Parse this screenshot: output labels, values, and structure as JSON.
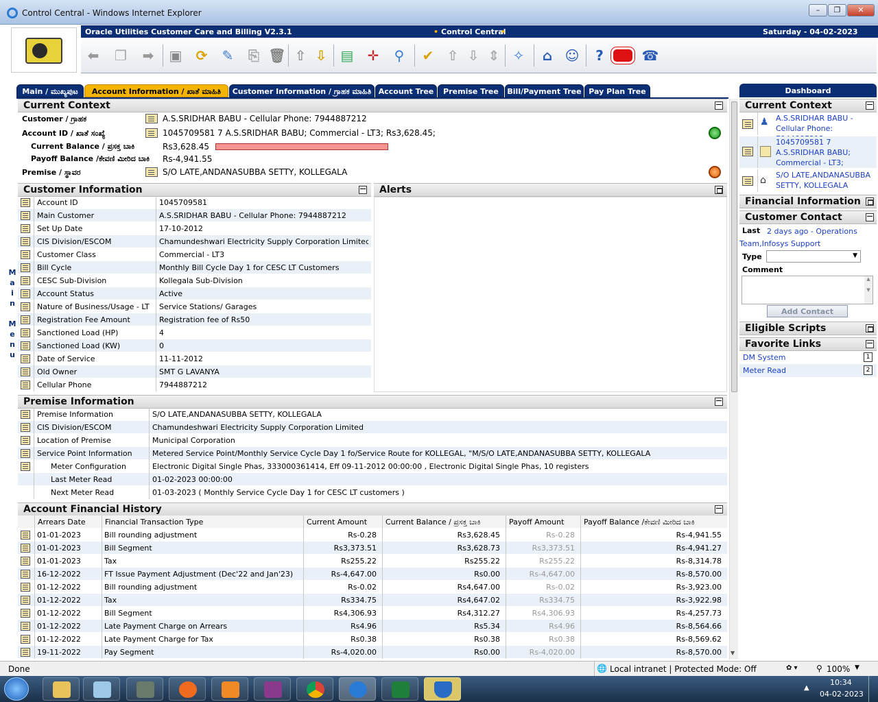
{
  "window": {
    "title": "Control Central - Windows Internet Explorer"
  },
  "app": {
    "product": "Oracle Utilities Customer Care and Billing V2.3.1",
    "portal": "Control Central",
    "date": "Saturday - 04-02-2023"
  },
  "tabs": [
    "Main / ಮುಖ್ಯಪುಟ",
    "Account Information / ಖಾತೆ ಮಾಹಿತಿ",
    "Customer Information / ಗ್ರಾಹಕ ಮಾಹಿತಿ",
    "Account Tree",
    "Premise Tree",
    "Bill/Payment Tree",
    "Pay Plan Tree"
  ],
  "main_menu": [
    "M",
    "a",
    "i",
    "n",
    "",
    "M",
    "e",
    "n",
    "u"
  ],
  "context": {
    "title": "Current Context",
    "customer_label": "Customer / ಗ್ರಾಹಕ",
    "customer_value": "A.S.SRIDHAR BABU - Cellular Phone: 7944887212",
    "account_label": "Account ID / ಖಾತೆ ಸಂಖ್ಯೆ",
    "account_value": "1045709581 7 A.S.SRIDHAR BABU; Commercial - LT3; Rs3,628.45;",
    "cur_bal_label": "Current Balance / ಪ್ರಸಕ್ತ ಬಾಕಿ",
    "cur_bal_value": "Rs3,628.45",
    "payoff_label": "Payoff Balance /ಕೇವಣಿ ಮೀರಿದ ಬಾಕಿ",
    "payoff_value": "Rs-4,941.55",
    "premise_label": "Premise / ಸ್ಥಾವರ",
    "premise_value": "S/O LATE,ANDANASUBBA SETTY, KOLLEGALA"
  },
  "customer_info": {
    "title": "Customer Information",
    "rows": [
      [
        "Account ID",
        "1045709581"
      ],
      [
        "Main Customer",
        "A.S.SRIDHAR BABU - Cellular Phone: 7944887212"
      ],
      [
        "Set Up Date",
        "17-10-2012"
      ],
      [
        "CIS Division/ESCOM",
        "Chamundeshwari Electricity Supply Corporation Limited"
      ],
      [
        "Customer Class",
        "Commercial - LT3"
      ],
      [
        "Bill Cycle",
        "Monthly Bill Cycle Day 1 for CESC LT Customers"
      ],
      [
        "CESC Sub-Division",
        "Kollegala Sub-Division"
      ],
      [
        "Account Status",
        "Active"
      ],
      [
        "Nature of Business/Usage - LT",
        "Service Stations/ Garages"
      ],
      [
        "Registration Fee Amount",
        "Registration fee of Rs50"
      ],
      [
        "Sanctioned Load (HP)",
        "4"
      ],
      [
        "Sanctioned Load (KW)",
        "0"
      ],
      [
        "Date of Service",
        "11-11-2012"
      ],
      [
        "Old Owner",
        "SMT G LAVANYA"
      ],
      [
        "Cellular Phone",
        "7944887212"
      ]
    ]
  },
  "alerts": {
    "title": "Alerts"
  },
  "premise_info": {
    "title": "Premise Information",
    "rows": [
      [
        "Premise Information",
        "S/O LATE,ANDANASUBBA SETTY, KOLLEGALA"
      ],
      [
        "CIS Division/ESCOM",
        "Chamundeshwari Electricity Supply Corporation Limited"
      ],
      [
        "Location of Premise",
        "Municipal Corporation"
      ],
      [
        "Service Point Information",
        "Metered Service Point/Monthly Service Cycle Day 1 fo/Service Route for KOLLEGAL, \"M/S/O LATE,ANDANASUBBA SETTY, KOLLEGALA"
      ],
      [
        "Meter Configuration",
        "Electronic Digital Single Phas, 333000361414, Eff 09-11-2012 00:00:00 , Electronic Digital Single Phas, 10 registers"
      ],
      [
        "Last Meter Read",
        "01-02-2023 00:00:00"
      ],
      [
        "Next Meter Read",
        "01-03-2023 ( Monthly Service Cycle Day 1 for CESC LT customers )"
      ]
    ]
  },
  "fin_history": {
    "title": "Account Financial History",
    "headers": [
      "Arrears Date",
      "Financial Transaction Type",
      "Current Amount",
      "Current Balance / ಪ್ರಸಕ್ತ ಬಾಕಿ",
      "Payoff Amount",
      "Payoff Balance /ಕೇವಣಿ ಮೀರಿದ ಬಾಕಿ"
    ],
    "rows": [
      [
        "01-01-2023",
        "Bill rounding adjustment",
        "Rs-0.28",
        "Rs3,628.45",
        "Rs-0.28",
        "Rs-4,941.55"
      ],
      [
        "01-01-2023",
        "Bill Segment",
        "Rs3,373.51",
        "Rs3,628.73",
        "Rs3,373.51",
        "Rs-4,941.27"
      ],
      [
        "01-01-2023",
        "Tax",
        "Rs255.22",
        "Rs255.22",
        "Rs255.22",
        "Rs-8,314.78"
      ],
      [
        "16-12-2022",
        "FT Issue Payment Adjustment (Dec'22 and Jan'23)",
        "Rs-4,647.00",
        "Rs0.00",
        "Rs-4,647.00",
        "Rs-8,570.00"
      ],
      [
        "01-12-2022",
        "Bill rounding adjustment",
        "Rs-0.02",
        "Rs4,647.00",
        "Rs-0.02",
        "Rs-3,923.00"
      ],
      [
        "01-12-2022",
        "Tax",
        "Rs334.75",
        "Rs4,647.02",
        "Rs334.75",
        "Rs-3,922.98"
      ],
      [
        "01-12-2022",
        "Bill Segment",
        "Rs4,306.93",
        "Rs4,312.27",
        "Rs4,306.93",
        "Rs-4,257.73"
      ],
      [
        "01-12-2022",
        "Late Payment Charge on Arrears",
        "Rs4.96",
        "Rs5.34",
        "Rs4.96",
        "Rs-8,564.66"
      ],
      [
        "01-12-2022",
        "Late Payment Charge for Tax",
        "Rs0.38",
        "Rs0.38",
        "Rs0.38",
        "Rs-8,569.62"
      ],
      [
        "19-11-2022",
        "Pay Segment",
        "Rs-4,020.00",
        "Rs0.00",
        "Rs-4,020.00",
        "Rs-8,570.00"
      ]
    ]
  },
  "dashboard": {
    "title": "Dashboard",
    "current_context": "Current Context",
    "ctx_customer": "A.S.SRIDHAR BABU - Cellular Phone: 7944887212",
    "ctx_account": "1045709581 7 A.S.SRIDHAR BABU; Commercial - LT3; Rs3,628.45;",
    "ctx_premise": "S/O LATE,ANDANASUBBA SETTY, KOLLEGALA",
    "financial_info": "Financial Information",
    "customer_contact": "Customer Contact",
    "last_label": "Last",
    "last_value": "2 days ago - Operations Team,Infosys Support",
    "type_label": "Type",
    "comment_label": "Comment",
    "add_contact": "Add Contact",
    "eligible_scripts": "Eligible Scripts",
    "favorite_links": "Favorite Links",
    "links": [
      {
        "label": "DM System",
        "key": "1"
      },
      {
        "label": "Meter Read",
        "key": "2"
      }
    ]
  },
  "status": {
    "text": "Done",
    "zone": "Local intranet | Protected Mode: Off",
    "zoom": "100%"
  },
  "taskbar": {
    "time": "10:34",
    "date": "04-02-2023"
  }
}
